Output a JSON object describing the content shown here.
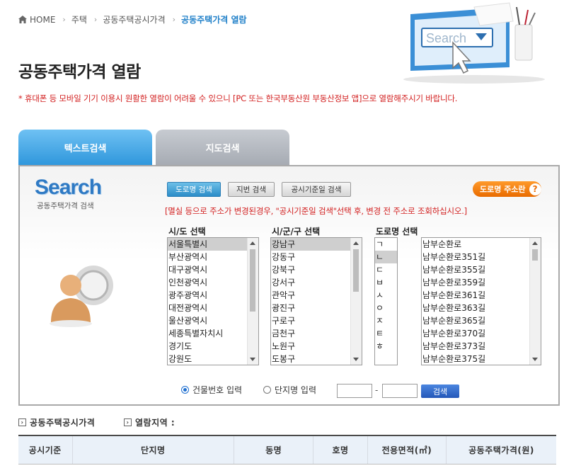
{
  "breadcrumb": {
    "home": "HOME",
    "items": [
      "주택",
      "공동주택공시가격"
    ],
    "current": "공동주택가격 열람"
  },
  "page_title": "공동주택가격 열람",
  "notice": "* 휴대폰 등 모바일 기기 이용시 원활한 열람이 어려울 수 있으니 [PC 또는 한국부동산원 부동산정보 앱]으로 열람해주시기 바랍니다.",
  "hero_search_text": "Search",
  "tabs": [
    {
      "label": "텍스트검색",
      "active": true
    },
    {
      "label": "지도검색",
      "active": false
    }
  ],
  "panel": {
    "logo_text": "Search",
    "logo_sub": "공동주택가격 검색",
    "search_buttons": [
      {
        "label": "도로명 검색",
        "active": true
      },
      {
        "label": "지번 검색",
        "active": false
      },
      {
        "label": "공시기준일 검색",
        "active": false
      }
    ],
    "road_address_button": "도로명 주소란",
    "warning": "[멸실 등으로 주소가 변경된경우, \"공시기준일 검색\"선택 후, 변경 전 주소로 조회하십시오.]",
    "sido": {
      "label": "시/도 선택",
      "items": [
        "서울특별시",
        "부산광역시",
        "대구광역시",
        "인천광역시",
        "광주광역시",
        "대전광역시",
        "울산광역시",
        "세종특별자치시",
        "경기도",
        "강원도"
      ],
      "selected_index": 0
    },
    "sigungu": {
      "label": "시/군/구 선택",
      "items": [
        "강남구",
        "강동구",
        "강북구",
        "강서구",
        "관악구",
        "광진구",
        "구로구",
        "금천구",
        "노원구",
        "도봉구"
      ],
      "selected_index": 0
    },
    "road_initial": {
      "label": "도로명 선택",
      "items": [
        "ㄱ",
        "ㄴ",
        "ㄷ",
        "ㅂ",
        "ㅅ",
        "ㅇ",
        "ㅈ",
        "ㅌ",
        "ㅎ"
      ],
      "selected_index": 1
    },
    "road_names": {
      "items": [
        "남부순환로",
        "남부순환로351길",
        "남부순환로355길",
        "남부순환로359길",
        "남부순환로361길",
        "남부순환로363길",
        "남부순환로365길",
        "남부순환로370길",
        "남부순환로373길",
        "남부순환로375길"
      ]
    },
    "radio_options": [
      {
        "label": "건물번호 입력",
        "checked": true
      },
      {
        "label": "단지명 입력",
        "checked": false
      }
    ],
    "range_separator": "-",
    "search_submit": "검색"
  },
  "result_labels": {
    "price_label": "공동주택공시가격",
    "region_label": "열람지역 :"
  },
  "table": {
    "columns": [
      "공시기준",
      "단지명",
      "동명",
      "호명",
      "전용면적(㎡)",
      "공동주택가격(원)"
    ]
  },
  "colors": {
    "accent_blue": "#2f97dc",
    "warning_red": "#d21e1e",
    "orange": "#e96b00"
  }
}
